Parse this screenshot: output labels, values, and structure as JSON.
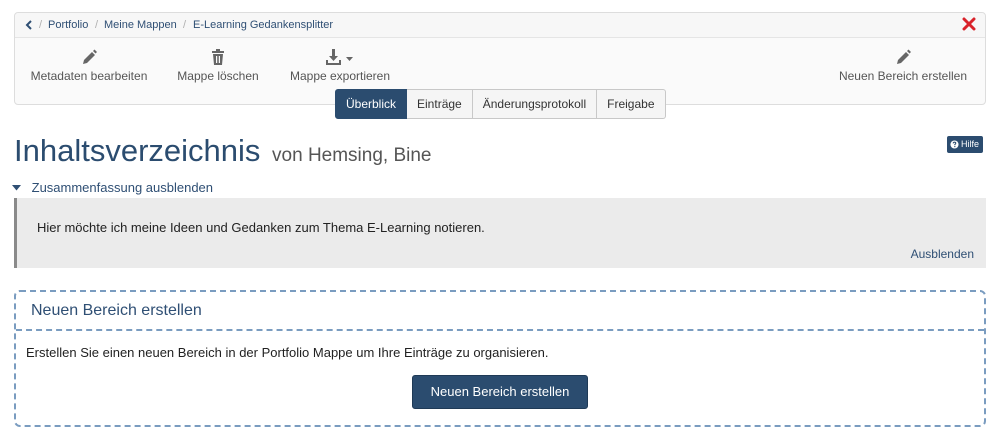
{
  "breadcrumb": {
    "items": [
      "Portfolio",
      "Meine Mappen",
      "E-Learning Gedankensplitter"
    ]
  },
  "toolbar": {
    "edit_metadata": "Metadaten bearbeiten",
    "delete_folder": "Mappe löschen",
    "export_folder": "Mappe exportieren",
    "new_section": "Neuen Bereich erstellen"
  },
  "tabs": [
    {
      "label": "Überblick",
      "active": true
    },
    {
      "label": "Einträge",
      "active": false
    },
    {
      "label": "Änderungsprotokoll",
      "active": false
    },
    {
      "label": "Freigabe",
      "active": false
    }
  ],
  "header": {
    "title": "Inhaltsverzeichnis",
    "owner": "von Hemsing, Bine",
    "help_label": "Hilfe"
  },
  "summary": {
    "toggle_label": "Zusammenfassung ausblenden",
    "text": "Hier möchte ich meine Ideen und Gedanken zum Thema E-Learning notieren.",
    "hide_label": "Ausblenden"
  },
  "new_section": {
    "title": "Neuen Bereich erstellen",
    "description": "Erstellen Sie einen neuen Bereich in der Portfolio Mappe um Ihre Einträge zu organisieren.",
    "button_label": "Neuen Bereich erstellen"
  },
  "icons": {
    "back": "chevron-left-icon",
    "close": "close-icon",
    "edit": "pencil-icon",
    "delete": "trash-icon",
    "export": "download-icon",
    "help": "question-circle-icon",
    "collapse": "caret-down-icon"
  },
  "colors": {
    "primary": "#2b4c6f",
    "link": "#2f4f74",
    "close": "#d9222a",
    "dashed_border": "#7a9cc0"
  }
}
